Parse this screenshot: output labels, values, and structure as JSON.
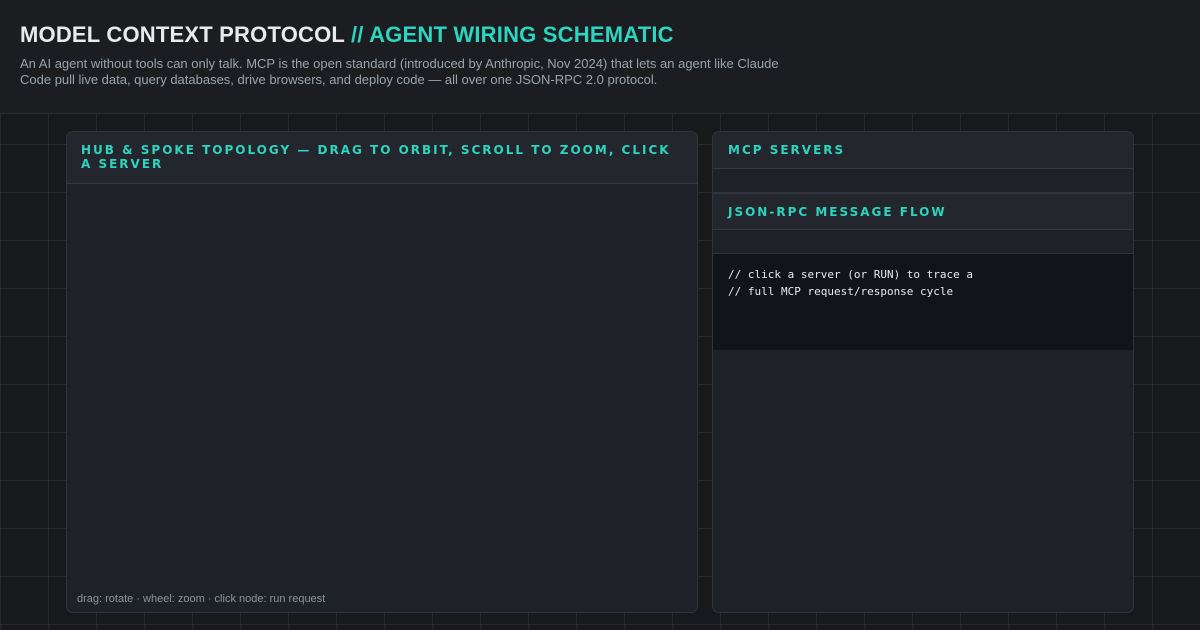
{
  "header": {
    "title_main": "MODEL CONTEXT PROTOCOL",
    "title_accent": "// AGENT WIRING SCHEMATIC",
    "subtitle": "An AI agent without tools can only talk. MCP is the open standard (introduced by Anthropic, Nov 2024) that lets an agent like Claude Code pull live data, query databases, drive browsers, and deploy code — all over one JSON-RPC 2.0 protocol."
  },
  "topology": {
    "heading": "Hub & Spoke Topology — Drag to Orbit, Scroll to Zoom, Click a Server",
    "hint": "drag: rotate · wheel: zoom · click node: run request"
  },
  "servers": {
    "heading": "MCP Servers"
  },
  "flow": {
    "heading": "JSON-RPC Message Flow",
    "console_lines": [
      "// click a server (or RUN) to trace a",
      "// full MCP request/response cycle"
    ]
  },
  "colors": {
    "accent": "#2dd4bf",
    "background": "#17191c",
    "panel": "#1e2128",
    "console": "#111418"
  }
}
